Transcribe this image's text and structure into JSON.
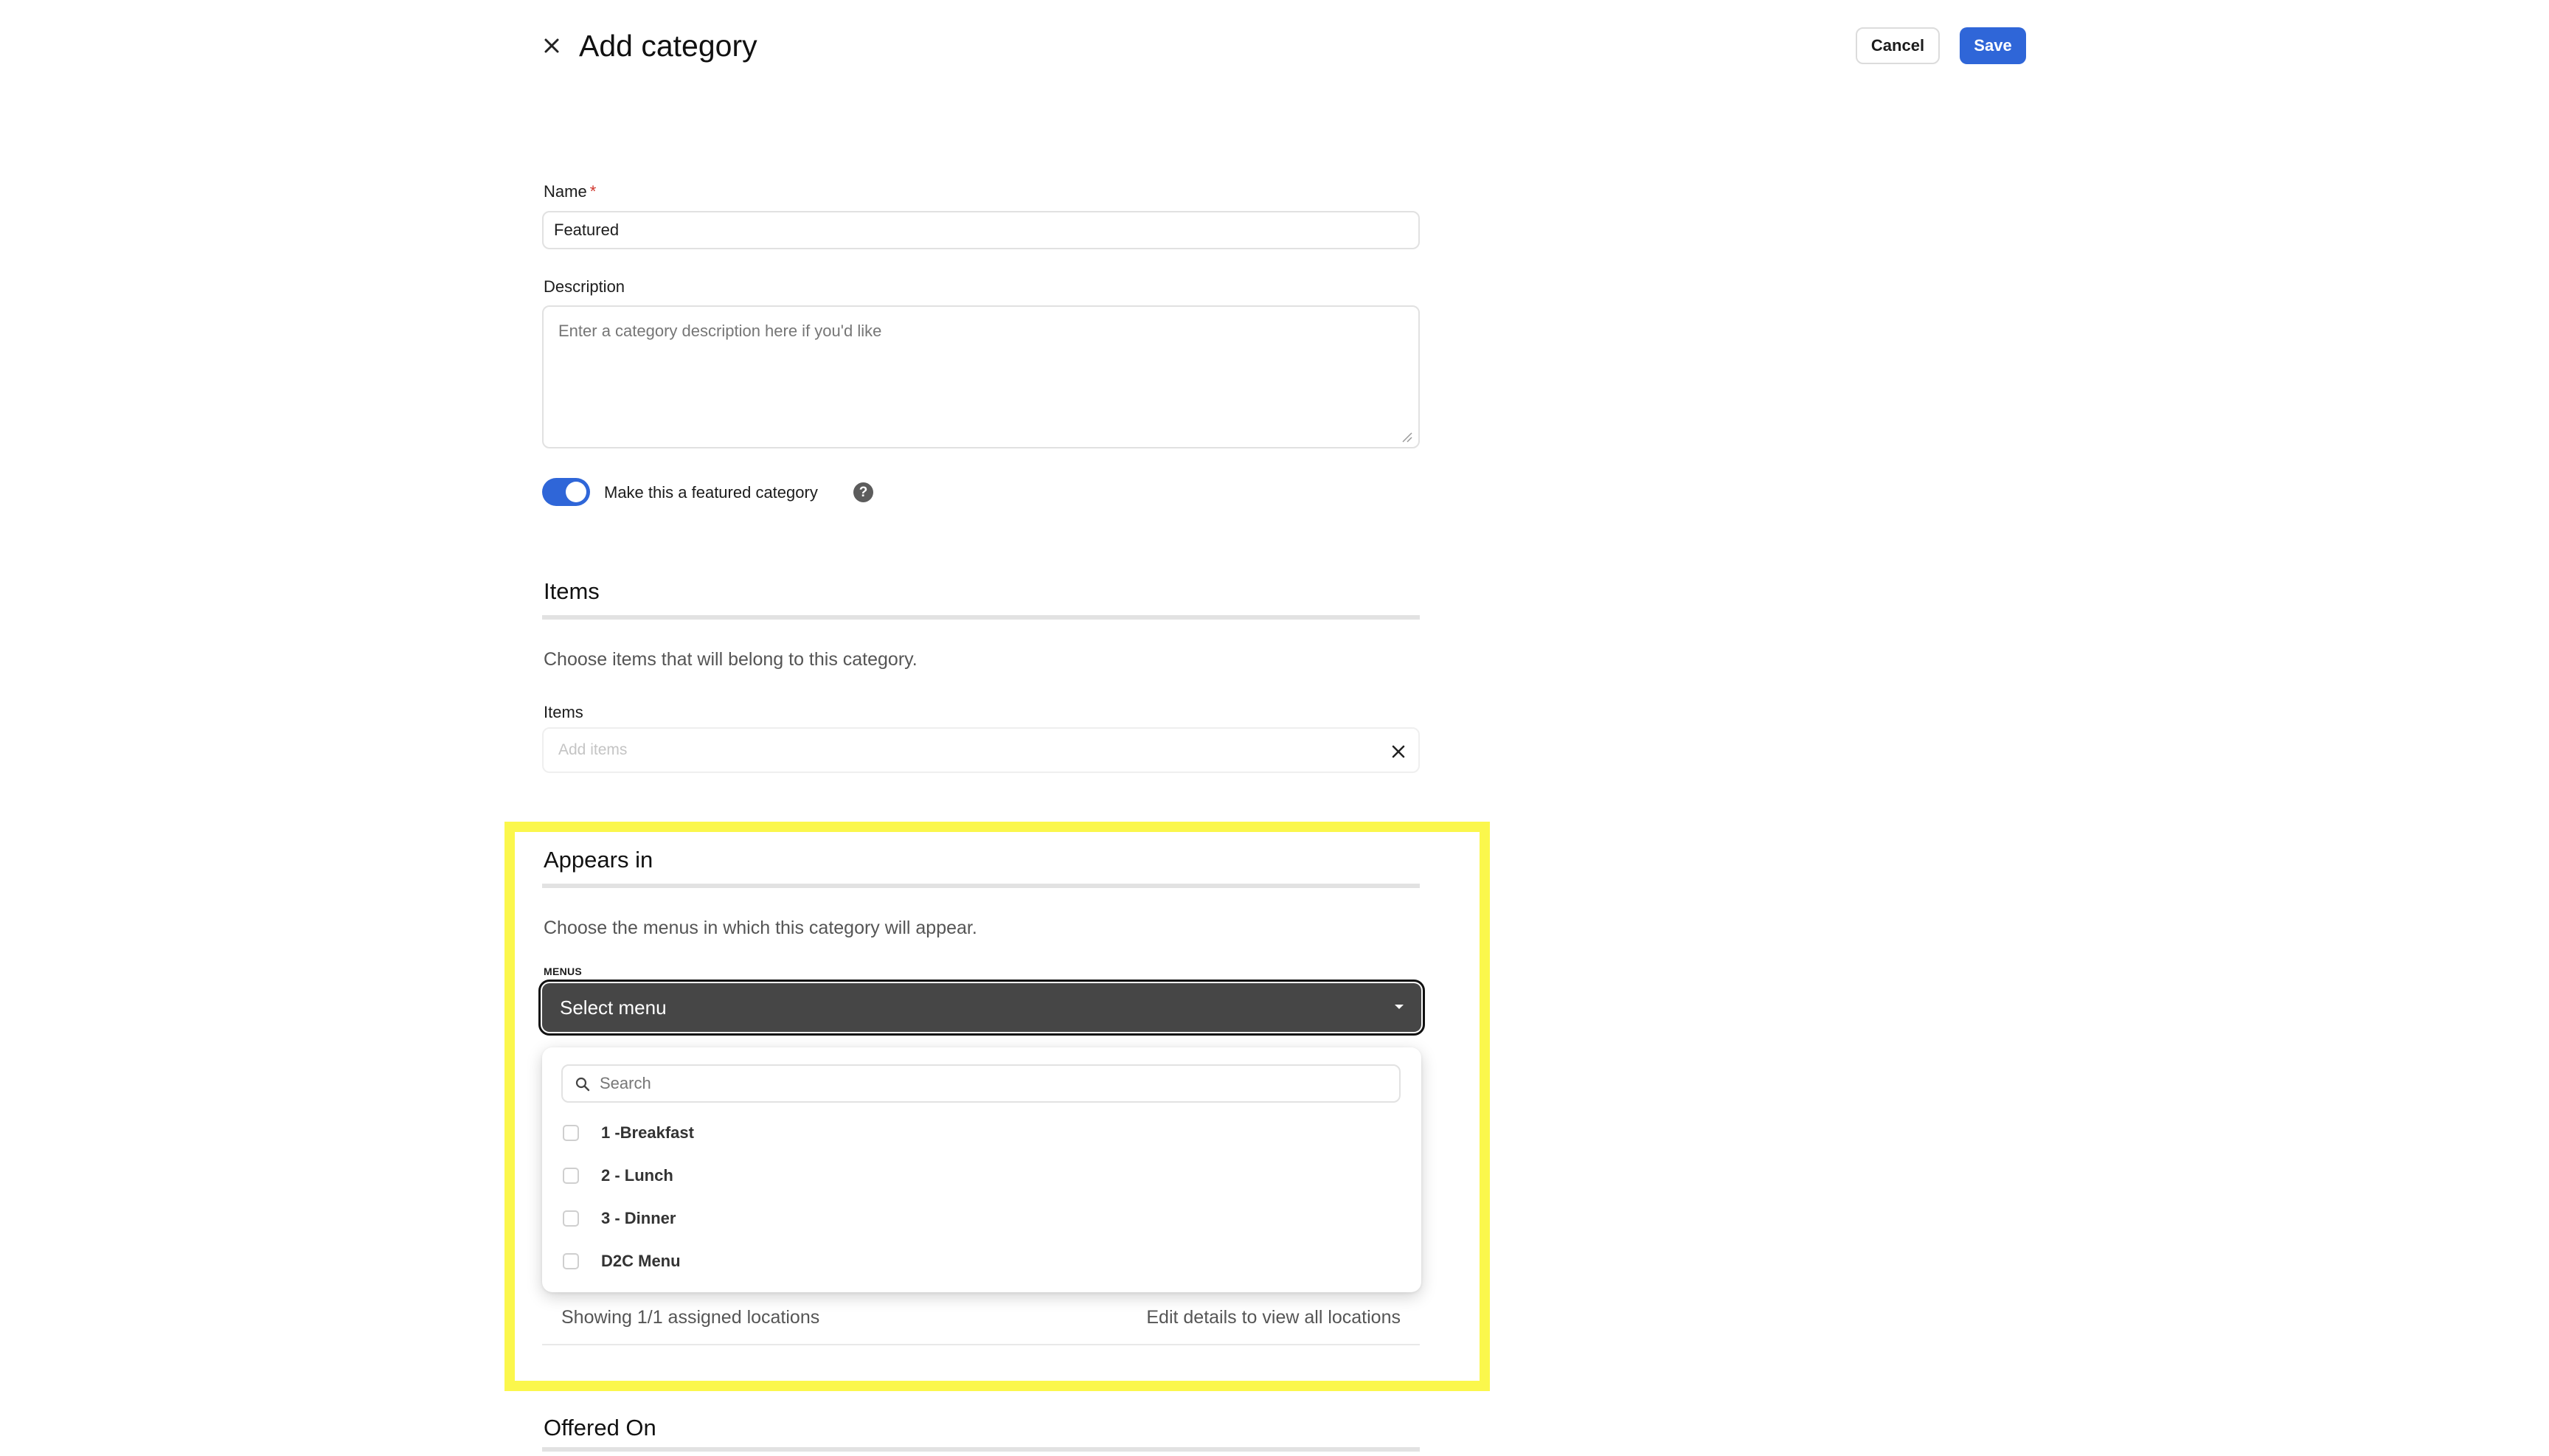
{
  "header": {
    "title": "Add category",
    "cancel_label": "Cancel",
    "save_label": "Save",
    "close_icon": "close-icon"
  },
  "form": {
    "name": {
      "label": "Name",
      "required_mark": "*",
      "value": "Featured"
    },
    "description": {
      "label": "Description",
      "placeholder": "Enter a category description here if you'd like"
    },
    "featured_toggle": {
      "label": "Make this a featured category",
      "on": true,
      "help_glyph": "?"
    }
  },
  "items_section": {
    "title": "Items",
    "description": "Choose items that will belong to this category.",
    "field_label": "Items",
    "placeholder": "Add items"
  },
  "appears_in": {
    "title": "Appears in",
    "description": "Choose the menus in which this category will appear.",
    "menus_label": "MENUS",
    "select_placeholder": "Select menu",
    "search_placeholder": "Search",
    "options": [
      {
        "label": "1 -Breakfast",
        "checked": false
      },
      {
        "label": "2 - Lunch",
        "checked": false
      },
      {
        "label": "3 - Dinner",
        "checked": false
      },
      {
        "label": "D2C Menu",
        "checked": false
      }
    ],
    "locations_summary": "Showing 1/1 assigned locations",
    "locations_link": "Edit details to view all locations"
  },
  "offered_on": {
    "title": "Offered On"
  },
  "colors": {
    "primary": "#2f66d8",
    "highlight": "#fbf74c",
    "select_bg": "#464646"
  }
}
